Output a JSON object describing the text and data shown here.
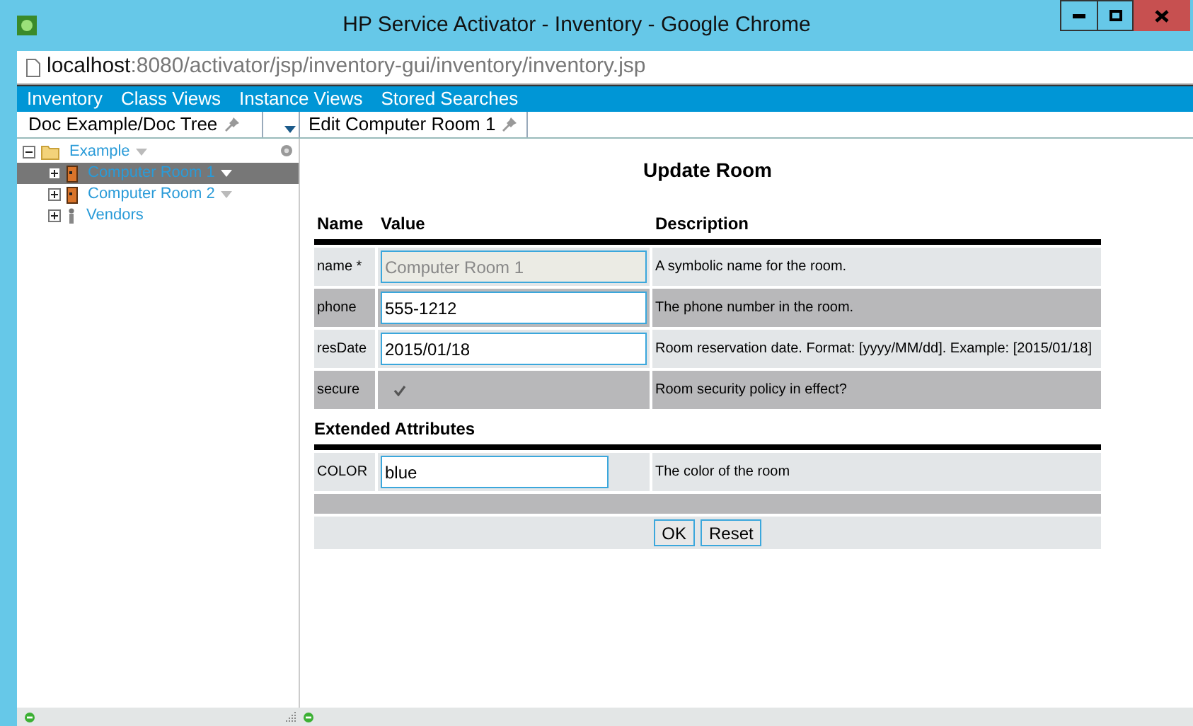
{
  "window": {
    "title": "HP Service Activator - Inventory - Google Chrome"
  },
  "address_bar": {
    "host": "localhost",
    "path": ":8080/activator/jsp/inventory-gui/inventory/inventory.jsp"
  },
  "menu": [
    {
      "label": "Inventory"
    },
    {
      "label": "Class Views"
    },
    {
      "label": "Instance Views"
    },
    {
      "label": "Stored Searches"
    }
  ],
  "left_tab": {
    "label": "Doc Example/Doc Tree"
  },
  "right_tab": {
    "label": "Edit Computer Room 1"
  },
  "tree": [
    {
      "label": "Example",
      "kind": "folder",
      "expanded": true,
      "selected": false,
      "children": [
        {
          "label": "Computer Room 1",
          "kind": "room",
          "expanded": false,
          "selected": true
        },
        {
          "label": "Computer Room 2",
          "kind": "room",
          "expanded": false,
          "selected": false
        },
        {
          "label": "Vendors",
          "kind": "vendor",
          "expanded": false,
          "selected": false
        }
      ]
    }
  ],
  "form": {
    "title": "Update Room",
    "columns": [
      "Name",
      "Value",
      "Description"
    ],
    "rows": [
      {
        "name": "name *",
        "kind": "text",
        "value": "Computer Room 1",
        "disabled": true,
        "description": "A symbolic name for the room."
      },
      {
        "name": "phone",
        "kind": "text",
        "value": "555-1212",
        "disabled": false,
        "description": "The phone number in the room."
      },
      {
        "name": "resDate",
        "kind": "text",
        "value": "2015/01/18",
        "disabled": false,
        "description": "Room reservation date. Format: [yyyy/MM/dd]. Example: [2015/01/18]"
      },
      {
        "name": "secure",
        "kind": "checkbox",
        "checked": true,
        "description": "Room security policy in effect?"
      }
    ],
    "extended_title": "Extended Attributes",
    "extended_rows": [
      {
        "name": "COLOR",
        "kind": "text",
        "value": "blue",
        "disabled": false,
        "description": "The color of the room"
      }
    ],
    "buttons": [
      "OK",
      "Reset"
    ]
  }
}
